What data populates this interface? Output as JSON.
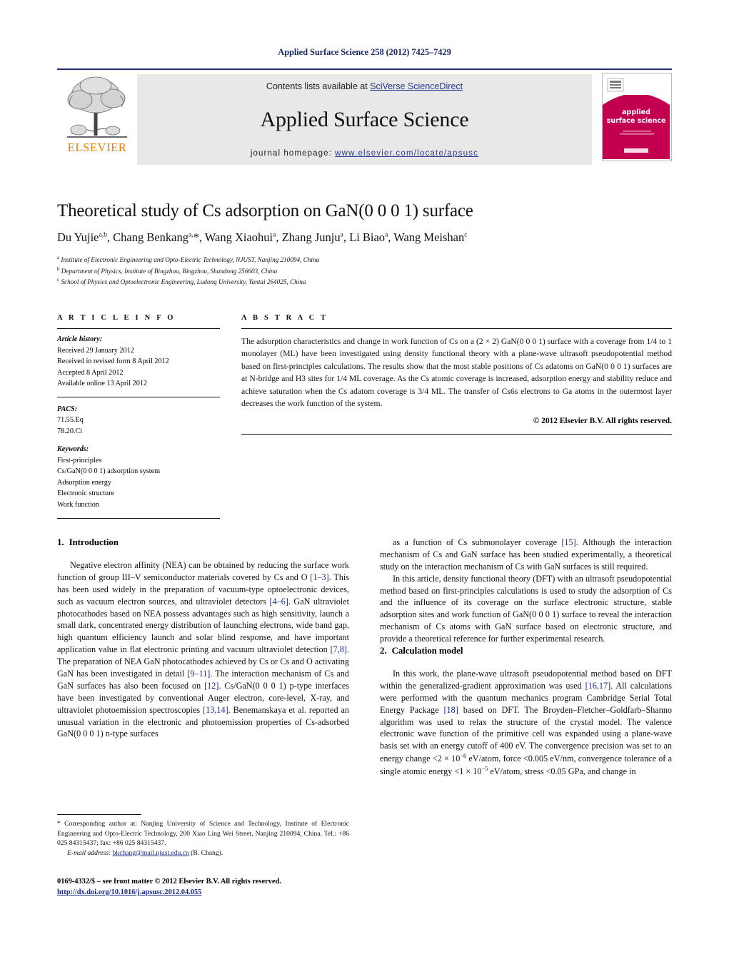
{
  "header": {
    "running_head": "Applied Surface Science 258 (2012) 7425–7429",
    "contents_prefix": "Contents lists available at ",
    "contents_link": "SciVerse ScienceDirect",
    "journal_name": "Applied Surface Science",
    "homepage_prefix": "journal homepage: ",
    "homepage_url": "www.elsevier.com/locate/apsusc",
    "publisher_wordmark": "ELSEVIER",
    "cover_line1": "applied",
    "cover_line2": "surface science",
    "colors": {
      "heading_navy": "#1b2a6b",
      "link_blue": "#2a3a8f",
      "elsevier_orange": "#f07d00",
      "cover_magenta": "#c2004f",
      "band_grey": "#e8e8e8"
    }
  },
  "title_block": {
    "title": "Theoretical study of Cs adsorption on GaN(0 0 0 1) surface",
    "authors": "Du Yujie<sup>a,b</sup>, Chang Benkang<sup>a,</sup>*, Wang Xiaohui<sup>a</sup>, Zhang Junju<sup>a</sup>, Li Biao<sup>a</sup>, Wang Meishan<sup>c</sup>",
    "affiliations": [
      "<sup>a</sup> Institute of Electronic Engineering and Opto-Electric Technology, NJUST, Nanjing 210094, China",
      "<sup>b</sup> Department of Physics, Institute of Bingzhou, Bingzhou, Shandong 256603, China",
      "<sup>c</sup> School of Physics and Optoelectronic Engineering, Ludong University, Yantai 264025, China"
    ]
  },
  "article_info": {
    "heading": "A R T I C L E   I N F O",
    "history_label": "Article history:",
    "history": [
      "Received 29 January 2012",
      "Received in revised form 8 April 2012",
      "Accepted 8 April 2012",
      "Available online 13 April 2012"
    ],
    "pacs_label": "PACS:",
    "pacs": [
      "71.55.Eq",
      "78.20.Ci"
    ],
    "keywords_label": "Keywords:",
    "keywords": [
      "First-principles",
      "Cs/GaN(0 0 0 1) adsorption system",
      "Adsorption energy",
      "Electronic structure",
      "Work function"
    ]
  },
  "abstract": {
    "heading": "A B S T R A C T",
    "text": "The adsorption characteristics and change in work function of Cs on a (2 × 2) GaN(0 0 0 1) surface with a coverage from 1/4 to 1 monolayer (ML) have been investigated using density functional theory with a plane-wave ultrasoft pseudopotential method based on first-principles calculations. The results show that the most stable positions of Cs adatoms on GaN(0 0 0 1) surfaces are at N-bridge and H3 sites for 1/4 ML coverage. As the Cs atomic coverage is increased, adsorption energy and stability reduce and achieve saturation when the Cs adatom coverage is 3/4 ML. The transfer of Cs6s electrons to Ga atoms in the outermost layer decreases the work function of the system.",
    "copyright": "© 2012 Elsevier B.V. All rights reserved."
  },
  "sections": {
    "intro": {
      "number": "1.",
      "title": "Introduction",
      "paragraph": "Negative electron affinity (NEA) can be obtained by reducing the surface work function of group III–V semiconductor materials covered by Cs and O <span class=\"ref\">[1–3]</span>. This has been used widely in the preparation of vacuum-type optoelectronic devices, such as vacuum electron sources, and ultraviolet detectors <span class=\"ref\">[4–6]</span>. GaN ultraviolet photocathodes based on NEA possess advantages such as high sensitivity, launch a small dark, concentrated energy distribution of launching electrons, wide band gap, high quantum efficiency launch and solar blind response, and have important application value in flat electronic printing and vacuum ultraviolet detection <span class=\"ref\">[7,8]</span>. The preparation of NEA GaN photocathodes achieved by Cs or Cs and O activating GaN has been investigated in detail <span class=\"ref\">[9–11]</span>. The interaction mechanism of Cs and GaN surfaces has also been focused on <span class=\"ref\">[12]</span>. Cs/GaN(0 0 0 1) p-type interfaces have been investigated by conventional Auger electron, core-level, X-ray, and ultraviolet photoemission spectroscopies <span class=\"ref\">[13,14]</span>. Benemanskaya et al. reported an unusual variation in the electronic and photoemission properties of Cs-adsorbed GaN(0 0 0 1) n-type surfaces"
    },
    "intro_cont": {
      "paragraph1": "as a function of Cs submonolayer coverage <span class=\"ref\">[15]</span>. Although the interaction mechanism of Cs and GaN surface has been studied experimentally, a theoretical study on the interaction mechanism of Cs with GaN surfaces is still required.",
      "paragraph2": "In this article, density functional theory (DFT) with an ultrasoft pseudopotential method based on first-principles calculations is used to study the adsorption of Cs and the influence of its coverage on the surface electronic structure, stable adsorption sites and work function of GaN(0 0 0 1) surface to reveal the interaction mechanism of Cs atoms with GaN surface based on electronic structure, and provide a theoretical reference for further experimental research."
    },
    "calc_model": {
      "number": "2.",
      "title": "Calculation model",
      "paragraph": "In this work, the plane-wave ultrasoft pseudopotential method based on DFT within the generalized-gradient approximation was used <span class=\"ref\">[16,17]</span>. All calculations were performed with the quantum mechanics program Cambridge Serial Total Energy Package <span class=\"ref\">[18]</span> based on DFT. The Broyden–Fletcher–Goldfarb–Shanno algorithm was used to relax the structure of the crystal model. The valence electronic wave function of the primitive cell was expanded using a plane-wave basis set with an energy cutoff of 400 eV. The convergence precision was set to an energy change &lt;2 × 10<sup class=\"inline\">−6</sup> eV/atom, force &lt;0.005 eV/nm, convergence tolerance of a single atomic energy &lt;1 × 10<sup class=\"inline\">−5</sup> eV/atom, stress &lt;0.05 GPa, and change in"
    }
  },
  "footnote": {
    "text": "* Corresponding author at: Nanjing University of Science and Technology, Institute of Electronic Engineering and Opto-Electric Technology, 200 Xiao Ling Wei Street, Nanjing 210094, China. Tel.: +86 025 84315437; fax: +86 025 84315437.",
    "email_label": "E-mail address:",
    "email": "bkchang@mail.njust.edu.cn",
    "email_suffix": "(B. Chang)."
  },
  "footer": {
    "issn_line": "0169-4332/$ – see front matter © 2012 Elsevier B.V. All rights reserved.",
    "doi": "http://dx.doi.org/10.1016/j.apsusc.2012.04.055"
  }
}
